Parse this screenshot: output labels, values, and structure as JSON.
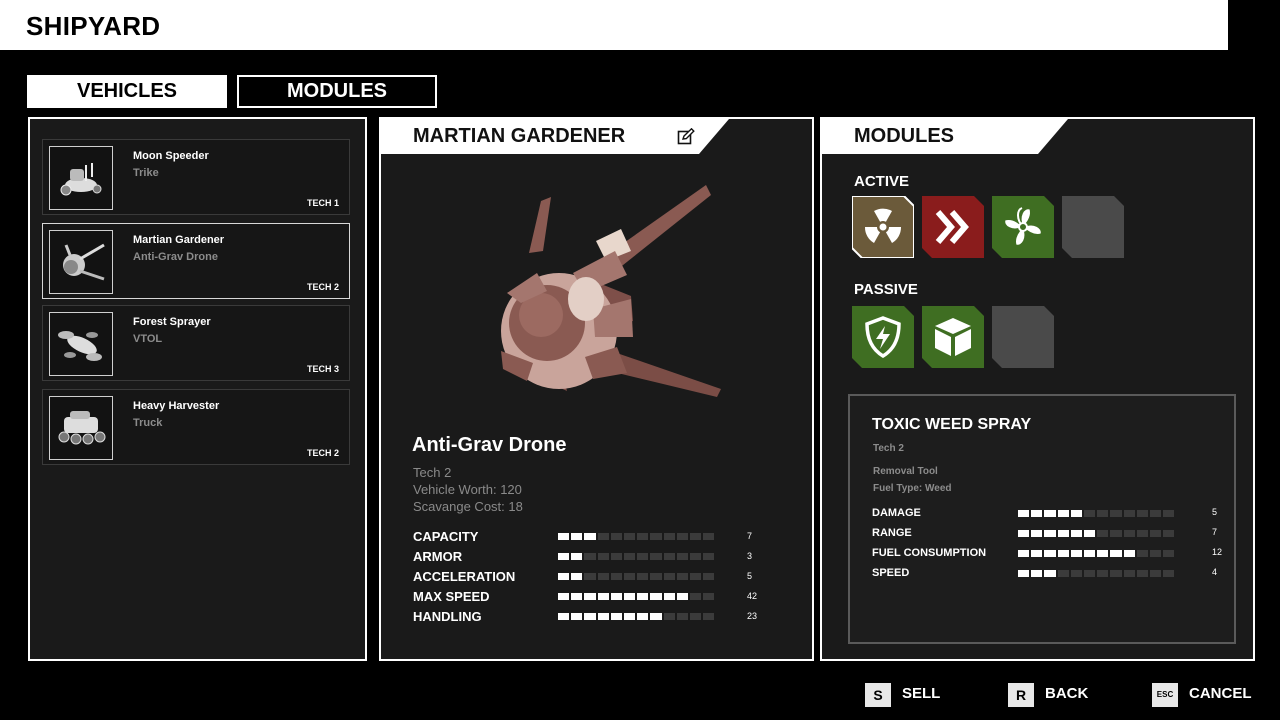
{
  "header": {
    "title": "SHIPYARD"
  },
  "tabs": {
    "vehicles": "VEHICLES",
    "modules": "MODULES"
  },
  "vehicle_list": [
    {
      "name": "Moon Speeder",
      "type": "Trike",
      "tech": "TECH 1",
      "icon": "trike-icon"
    },
    {
      "name": "Martian Gardener",
      "type": "Anti-Grav Drone",
      "tech": "TECH 2",
      "icon": "drone-icon",
      "selected": true
    },
    {
      "name": "Forest Sprayer",
      "type": "VTOL",
      "tech": "TECH 3",
      "icon": "vtol-icon"
    },
    {
      "name": "Heavy Harvester",
      "type": "Truck",
      "tech": "TECH 2",
      "icon": "truck-icon"
    }
  ],
  "vehicle": {
    "name": "MARTIAN GARDENER",
    "edit_icon": "edit-icon",
    "type_title": "Anti-Grav Drone",
    "tech": "Tech 2",
    "worth": "Vehicle Worth: 120",
    "scavenge": "Scavange Cost: 18",
    "stats": [
      {
        "label": "CAPACITY",
        "value": "7",
        "filled": 3
      },
      {
        "label": "ARMOR",
        "value": "3",
        "filled": 2
      },
      {
        "label": "ACCELERATION",
        "value": "5",
        "filled": 2
      },
      {
        "label": "MAX SPEED",
        "value": "42",
        "filled": 10
      },
      {
        "label": "HANDLING",
        "value": "23",
        "filled": 8
      }
    ],
    "bar_segments": 12
  },
  "modules": {
    "header": "MODULES",
    "active_label": "ACTIVE",
    "passive_label": "PASSIVE",
    "active_slots": [
      {
        "icon": "radiation-icon",
        "color": "#6b5a3a",
        "selected": true
      },
      {
        "icon": "double-chevron-icon",
        "color": "#8a1c1c"
      },
      {
        "icon": "fan-icon",
        "color": "#3f6e22"
      },
      {
        "icon": "empty-slot",
        "color": "#4a4a4a"
      }
    ],
    "passive_slots": [
      {
        "icon": "shield-bolt-icon",
        "color": "#3f6e22"
      },
      {
        "icon": "crate-icon",
        "color": "#3f6e22"
      },
      {
        "icon": "empty-slot",
        "color": "#4a4a4a"
      }
    ],
    "detail": {
      "title": "TOXIC WEED SPRAY",
      "tech": "Tech 2",
      "kind": "Removal Tool",
      "fuel": "Fuel Type: Weed",
      "stats": [
        {
          "label": "DAMAGE",
          "value": "5",
          "filled": 5
        },
        {
          "label": "RANGE",
          "value": "7",
          "filled": 6
        },
        {
          "label": "FUEL CONSUMPTION",
          "value": "12",
          "filled": 9
        },
        {
          "label": "SPEED",
          "value": "4",
          "filled": 3
        }
      ],
      "bar_segments": 12
    }
  },
  "footer": [
    {
      "key": "S",
      "label": "SELL"
    },
    {
      "key": "R",
      "label": "BACK"
    },
    {
      "key": "ESC",
      "label": "CANCEL"
    }
  ]
}
